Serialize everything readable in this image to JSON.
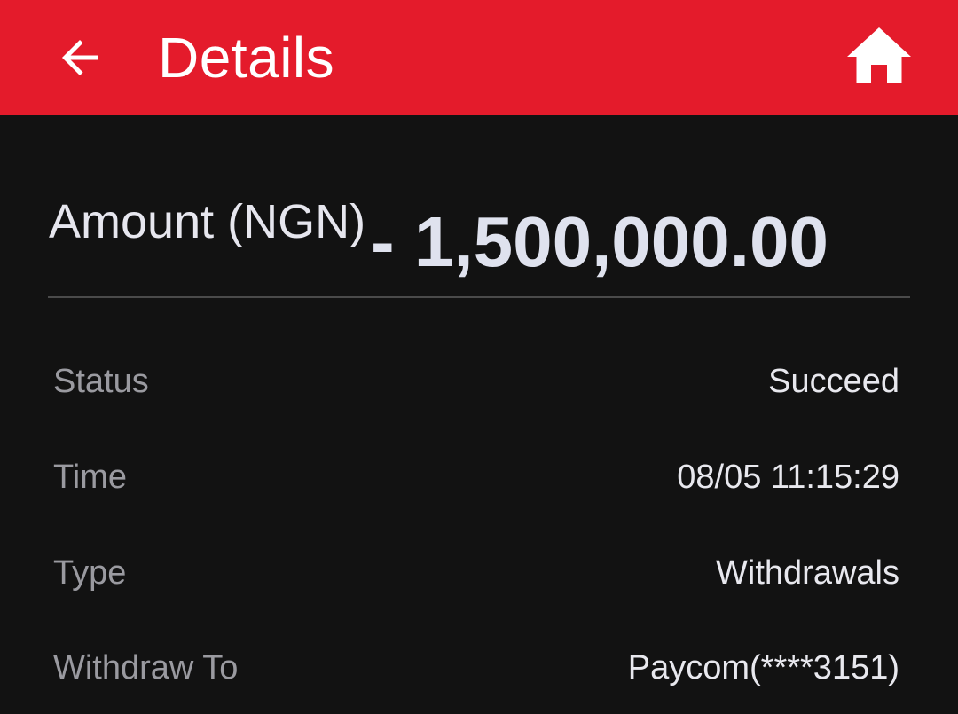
{
  "header": {
    "title": "Details",
    "back_icon": "arrow-left-icon",
    "home_icon": "home-icon",
    "background_color": "#E41B2B"
  },
  "amount": {
    "label": "Amount (NGN)",
    "value": "- 1,500,000.00"
  },
  "details": [
    {
      "label": "Status",
      "value": "Succeed"
    },
    {
      "label": "Time",
      "value": "08/05 11:15:29"
    },
    {
      "label": "Type",
      "value": "Withdrawals"
    },
    {
      "label": "Withdraw To",
      "value": "Paycom(****3151)"
    }
  ]
}
